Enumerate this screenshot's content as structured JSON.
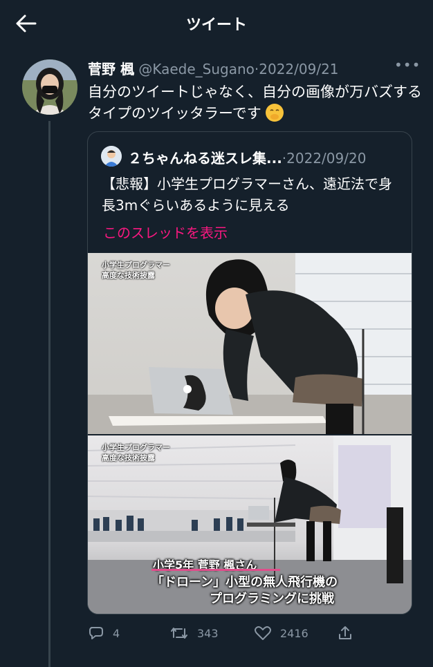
{
  "header": {
    "title": "ツイート"
  },
  "tweet": {
    "name": "菅野 楓",
    "handle": "@Kaede_Sugano",
    "sep": "·",
    "date": "2022/09/21",
    "more": "•••",
    "text": "自分のツイートじゃなく、自分の画像が万バズするタイプのツイッタラーです"
  },
  "quote": {
    "name": "２ちゃんねる迷スレ集...",
    "sep": "·",
    "date": "2022/09/20",
    "text": "【悲報】小学生プログラマーさん、遠近法で身長3mぐらいあるように見える",
    "show_thread": "このスレッドを表示",
    "media": {
      "caption_top": [
        "小学生プログラマー",
        "高度な技術披露"
      ],
      "caption_bottom": [
        "小学生プログラマー",
        "高度な技術披露"
      ],
      "sub_name": "小学5年 菅野 楓さん",
      "sub_line1": "「ドローン」小型の無人飛行機の",
      "sub_line2": "プログラミングに挑戦"
    }
  },
  "actions": {
    "replies": "4",
    "retweets": "343",
    "likes": "2416"
  }
}
